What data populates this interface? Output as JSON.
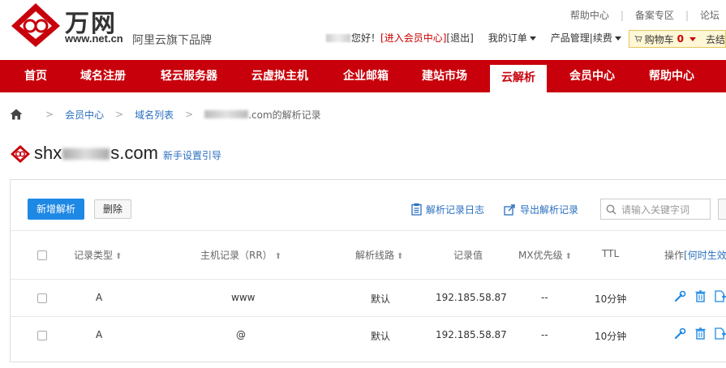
{
  "header": {
    "brand_name": "万网",
    "brand_url": "www.net.cn",
    "slogan": "阿里云旗下品牌",
    "top_links": [
      "帮助中心",
      "备案专区",
      "论坛"
    ],
    "user": {
      "greeting": "您好！",
      "member_center_link": "[进入会员中心]",
      "logout_link": "[退出]",
      "my_orders": "我的订单",
      "products": "产品管理|续费"
    },
    "cart": {
      "label": "购物车",
      "count": "0",
      "checkout": "去结"
    }
  },
  "nav": {
    "items": [
      "首页",
      "域名注册",
      "轻云服务器",
      "云虚拟主机",
      "企业邮箱",
      "建站市场",
      "云解析",
      "会员中心",
      "帮助中心"
    ],
    "active": "云解析"
  },
  "breadcrumb": {
    "items": [
      "会员中心",
      "域名列表"
    ],
    "current_suffix": ".com的解析记录"
  },
  "domain": {
    "prefix": "shx",
    "suffix": "s.com",
    "guide_link": "新手设置引导"
  },
  "toolbar": {
    "add_label": "新增解析",
    "delete_label": "删除",
    "log_label": "解析记录日志",
    "export_label": "导出解析记录",
    "search_placeholder": "请输入关键字词"
  },
  "table": {
    "columns": {
      "type": "记录类型",
      "host": "主机记录（RR）",
      "line": "解析线路",
      "value": "记录值",
      "mx": "MX优先级",
      "ttl": "TTL",
      "ops": "操作",
      "ops_link": "[何时生效"
    },
    "rows": [
      {
        "type": "A",
        "host": "www",
        "line": "默认",
        "value": "192.185.58.87",
        "mx": "--",
        "ttl": "10分钟"
      },
      {
        "type": "A",
        "host": "@",
        "line": "默认",
        "value": "192.185.58.87",
        "mx": "--",
        "ttl": "10分钟"
      }
    ]
  },
  "colors": {
    "brand_red": "#c8000b",
    "link_blue": "#2a6fbf",
    "primary_blue": "#1e88e5"
  }
}
